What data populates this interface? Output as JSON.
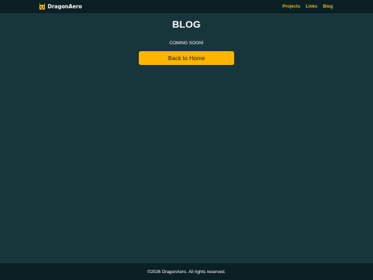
{
  "header": {
    "brand_name": "DragonAero",
    "logo_icon": "dragon-head-logo",
    "nav": [
      {
        "label": "Projects"
      },
      {
        "label": "Links"
      },
      {
        "label": "Blog"
      }
    ]
  },
  "main": {
    "title": "BLOG",
    "subtitle": "COMING SOON!",
    "back_button_label": "Back to Home"
  },
  "footer": {
    "copyright": "©2026 DragonAero. All rights reserved."
  },
  "colors": {
    "background": "#17363b",
    "header_footer": "#0b2025",
    "accent": "#ffb400",
    "nav_link": "#f2b51d",
    "text": "#ffffff"
  }
}
